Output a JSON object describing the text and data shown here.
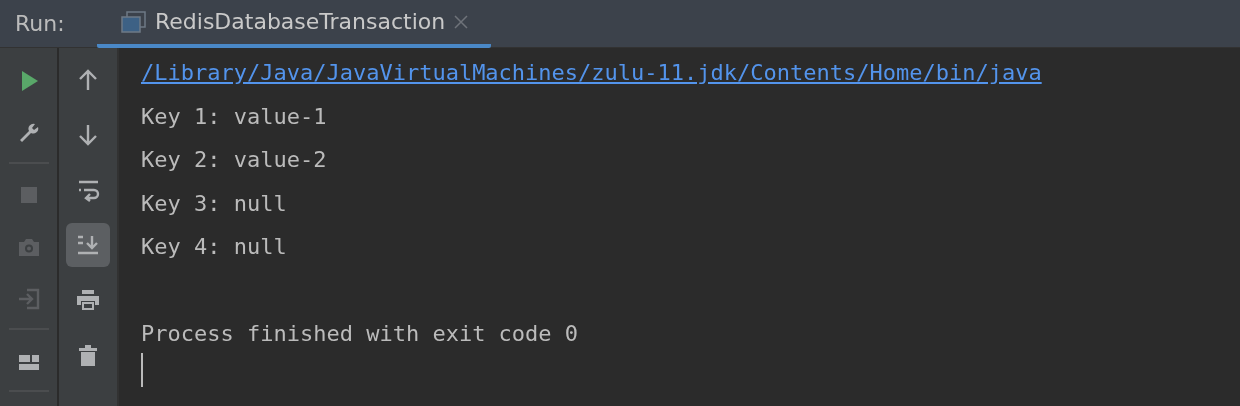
{
  "run_label": "Run:",
  "tab": {
    "title": "RedisDatabaseTransaction",
    "selected": true
  },
  "left_toolbar": [
    {
      "kind": "run",
      "disabled": false
    },
    {
      "kind": "wrench",
      "disabled": false
    },
    {
      "kind": "separator"
    },
    {
      "kind": "stop",
      "disabled": true
    },
    {
      "kind": "camera",
      "disabled": true
    },
    {
      "kind": "exit",
      "disabled": true
    },
    {
      "kind": "separator"
    },
    {
      "kind": "layout",
      "disabled": false
    },
    {
      "kind": "separator"
    }
  ],
  "right_toolbar": [
    {
      "kind": "up",
      "selected": false
    },
    {
      "kind": "down",
      "selected": false
    },
    {
      "kind": "wrap",
      "selected": false
    },
    {
      "kind": "scroll-end",
      "selected": true
    },
    {
      "kind": "print",
      "selected": false
    },
    {
      "kind": "trash",
      "selected": false
    }
  ],
  "console": {
    "lines": [
      {
        "kind": "link",
        "text": "/Library/Java/JavaVirtualMachines/zulu-11.jdk/Contents/Home/bin/java"
      },
      {
        "kind": "output",
        "text": "Key 1: value-1"
      },
      {
        "kind": "output",
        "text": "Key 2: value-2"
      },
      {
        "kind": "output",
        "text": "Key 3: null"
      },
      {
        "kind": "output",
        "text": "Key 4: null"
      },
      {
        "kind": "blank"
      },
      {
        "kind": "output",
        "text": "Process finished with exit code 0"
      }
    ],
    "caret": true
  }
}
